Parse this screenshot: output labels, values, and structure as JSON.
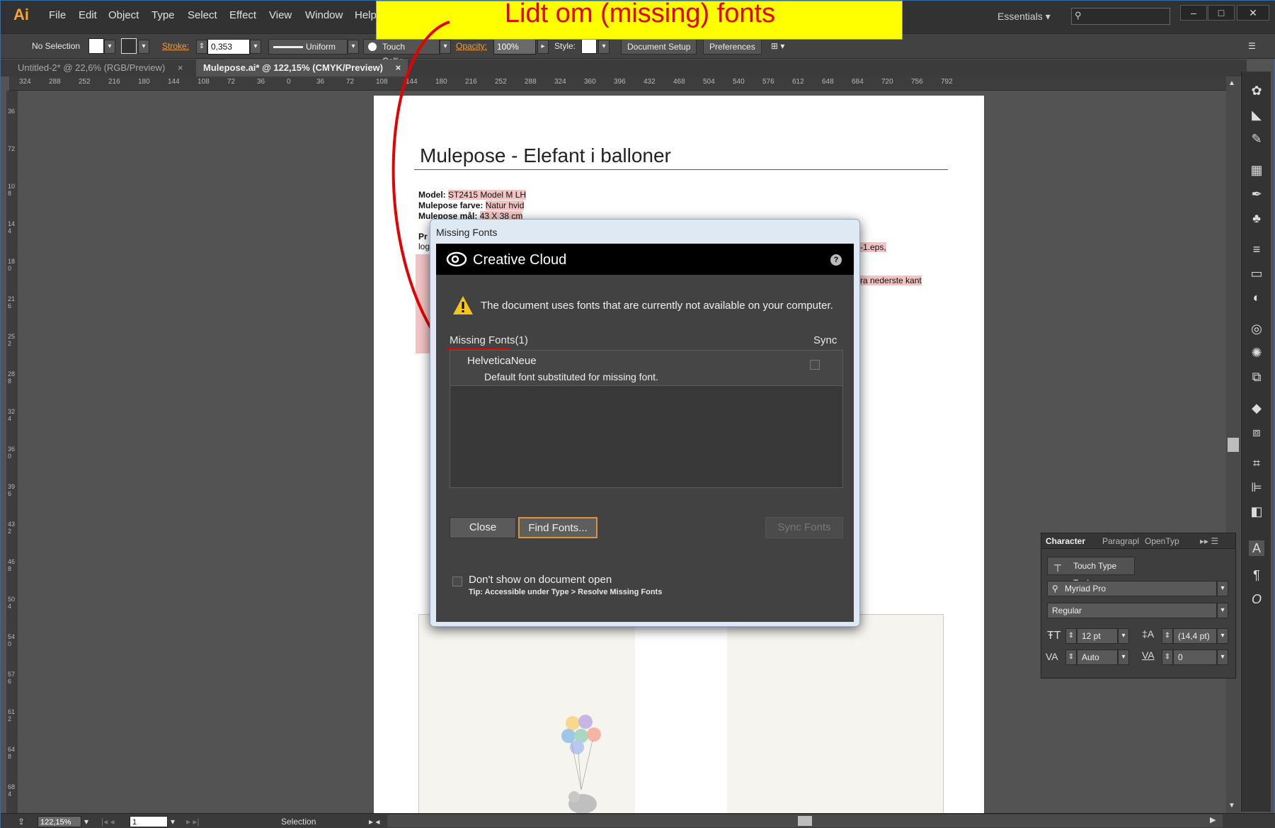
{
  "app": {
    "logo": "Ai",
    "menu": [
      "File",
      "Edit",
      "Object",
      "Type",
      "Select",
      "Effect",
      "View",
      "Window",
      "Help"
    ],
    "workspace": "Essentials"
  },
  "control_bar": {
    "selection": "No Selection",
    "stroke_label": "Stroke:",
    "stroke_value": "0,353 mm",
    "profile": "Uniform",
    "brush": "Touch Callig...",
    "opacity_label": "Opacity:",
    "opacity_value": "100%",
    "style_label": "Style:",
    "document_setup": "Document Setup",
    "preferences": "Preferences"
  },
  "tabs": [
    {
      "label": "Untitled-2* @ 22,6% (RGB/Preview)"
    },
    {
      "label": "Mulepose.ai* @ 122,15% (CMYK/Preview)"
    }
  ],
  "ruler": {
    "top_ticks": [
      "324",
      "288",
      "252",
      "216",
      "180",
      "144",
      "108",
      "72",
      "36",
      "0",
      "36",
      "72",
      "108",
      "144",
      "180",
      "216",
      "252",
      "288",
      "324",
      "360",
      "396",
      "432",
      "468",
      "504",
      "540",
      "576",
      "612",
      "648",
      "684",
      "720",
      "756",
      "792"
    ],
    "left_ticks": [
      "36",
      "72",
      "108",
      "144",
      "180",
      "216",
      "252",
      "288",
      "324",
      "360",
      "396",
      "432",
      "468",
      "504",
      "540",
      "576",
      "612",
      "648",
      "684"
    ]
  },
  "artboard": {
    "title": "Mulepose - Elefant i balloner",
    "model_label": "Model:",
    "model_value": "ST2415 Model M LH",
    "color_label": "Mulepose farve:",
    "color_value": "Natur hvid",
    "size_label": "Mulepose mål:",
    "size_value": "43 X 38 cm",
    "pr_label": "Pr",
    "log1": "log",
    "log2": "log",
    "eps_fragment": "-1.eps,",
    "edge_fragment": "ra nederste kant"
  },
  "dialog": {
    "title": "Missing Fonts",
    "brand": "Creative Cloud",
    "help": "?",
    "warning": "The document uses fonts that are currently not available on your computer.",
    "missing_header": "Missing Fonts(1)",
    "sync_header": "Sync",
    "font_name": "HelveticaNeue",
    "font_desc": "Default font substituted for missing font.",
    "close": "Close",
    "find_fonts": "Find Fonts...",
    "sync_fonts": "Sync Fonts",
    "dont_show": "Don't show on document open",
    "tip": "Tip: Accessible under Type > Resolve Missing Fonts"
  },
  "callout": {
    "text": "Lidt om (missing) fonts",
    "color": "#e60000",
    "background": "#ffff00"
  },
  "character_panel": {
    "tabs": [
      "Character",
      "Paragrapl",
      "OpenTyp"
    ],
    "tool": "Touch Type Tool",
    "font_family": "Myriad Pro",
    "font_style": "Regular",
    "size": "12 pt",
    "leading": "(14,4 pt)",
    "kerning": "Auto",
    "tracking": "0"
  },
  "status_bar": {
    "zoom": "122,15%",
    "page": "1",
    "tool": "Selection"
  }
}
